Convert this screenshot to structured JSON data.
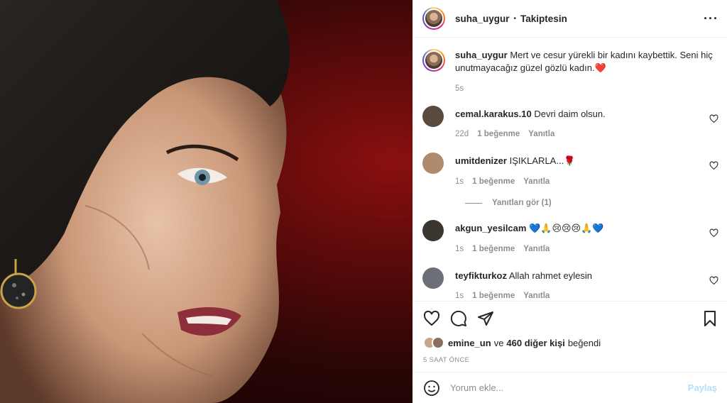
{
  "header": {
    "username": "suha_uygur",
    "separator": "•",
    "follow_state": "Takiptesin",
    "more_icon": "more-horizontal-icon"
  },
  "caption": {
    "username": "suha_uygur",
    "text": "Mert ve cesur yürekli bir kadını kaybettik. Seni hiç unutmayacağız güzel gözlü kadın.❤️",
    "age": "5s"
  },
  "comments": [
    {
      "username": "cemal.karakus.10",
      "text": "Devri daim olsun.",
      "age": "22d",
      "likes": "1 beğenme",
      "reply": "Yanıtla",
      "avatar_color": "#5b4a3e"
    },
    {
      "username": "umitdenizer",
      "text": "IŞIKLARLA...🌹",
      "age": "1s",
      "likes": "1 beğenme",
      "reply": "Yanıtla",
      "avatar_color": "#b08a6c",
      "view_replies": "Yanıtları gör (1)"
    },
    {
      "username": "akgun_yesilcam",
      "text": "💙🙏😢😢😢🙏💙",
      "age": "1s",
      "likes": "1 beğenme",
      "reply": "Yanıtla",
      "avatar_color": "#3b3530"
    },
    {
      "username": "teyfikturkoz",
      "text": "Allah rahmet eylesin",
      "age": "1s",
      "likes": "1 beğenme",
      "reply": "Yanıtla",
      "avatar_color": "#6b7078"
    }
  ],
  "likes": {
    "user": "emine_un",
    "middle": "ve",
    "others": "460 diğer kişi",
    "suffix": "beğendi"
  },
  "timestamp": "5 SAAT ÖNCE",
  "comment_box": {
    "placeholder": "Yorum ekle...",
    "post_label": "Paylaş"
  },
  "colors": {
    "accent_disabled": "#b2dffc",
    "text": "#262626",
    "muted": "#8e8e8e"
  }
}
